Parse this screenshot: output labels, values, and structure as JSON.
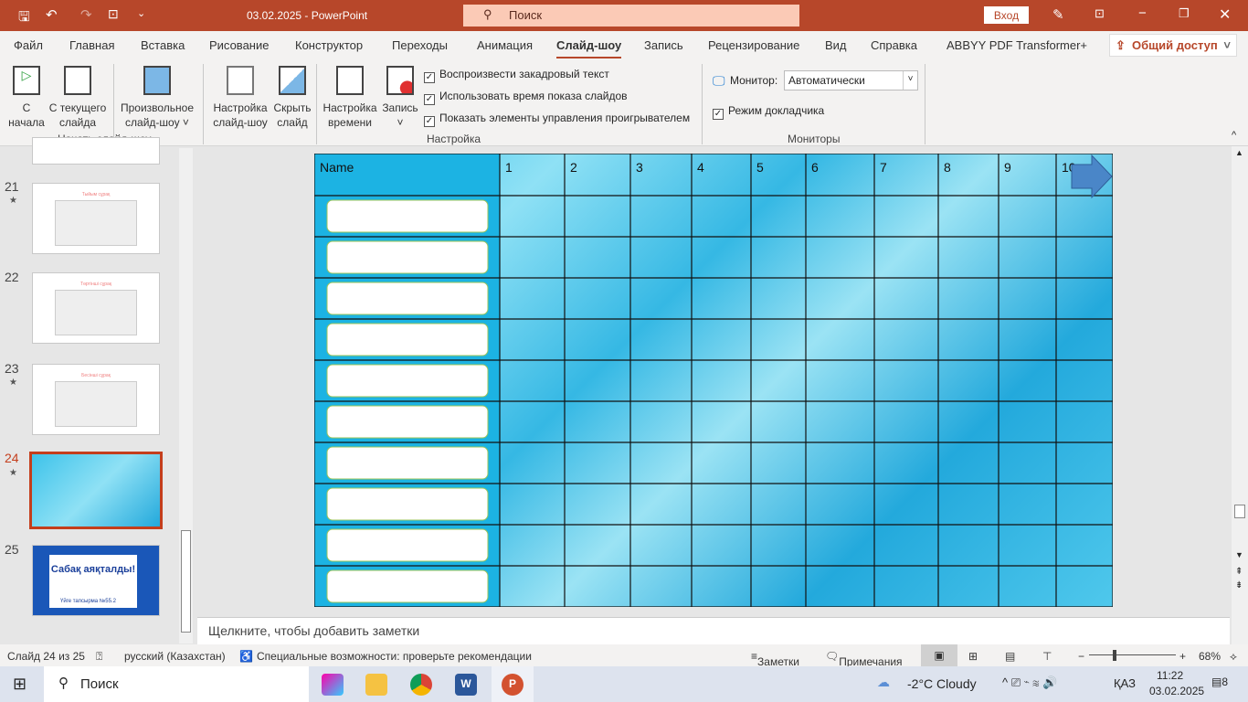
{
  "titlebar": {
    "title": "03.02.2025  -  PowerPoint",
    "search": "Поиск",
    "login": "Вход"
  },
  "tabs": [
    "Файл",
    "Главная",
    "Вставка",
    "Рисование",
    "Конструктор",
    "Переходы",
    "Анимация",
    "Слайд-шоу",
    "Запись",
    "Рецензирование",
    "Вид",
    "Справка",
    "ABBYY PDF Transformer+"
  ],
  "active_tab": "Слайд-шоу",
  "share": "Общий доступ",
  "ribbon": {
    "start": {
      "from_start": "С начала",
      "from_current": "С текущего слайда",
      "custom": "Произвольное слайд-шоу ˅",
      "group": "Начать слайд-шоу"
    },
    "setup": {
      "setup_show": "Настройка слайд-шоу",
      "hide_slide": "Скрыть слайд",
      "rehearse": "Настройка времени",
      "record": "Запись ˅",
      "group": "Настройка",
      "checks": [
        {
          "label": "Воспроизвести закадровый текст",
          "checked": true
        },
        {
          "label": "Использовать время показа слайдов",
          "checked": true
        },
        {
          "label": "Показать элементы управления проигрывателем",
          "checked": true
        }
      ]
    },
    "monitors": {
      "monitor_label": "Монитор:",
      "monitor_value": "Автоматически",
      "presenter": "Режим докладчика",
      "presenter_checked": true,
      "group": "Мониторы"
    }
  },
  "slides": [
    {
      "num": "21",
      "title": "Тыйым сұрақ"
    },
    {
      "num": "22",
      "title": "Төртінші сұрақ"
    },
    {
      "num": "23",
      "title": "Бесінші сұрақ"
    },
    {
      "num": "24",
      "selected": true
    },
    {
      "num": "25",
      "text": "Сабақ аяқталды!",
      "sub": "Үйге тапсырма №55.2"
    }
  ],
  "table": {
    "header": [
      "Name",
      "1",
      "2",
      "3",
      "4",
      "5",
      "6",
      "7",
      "8",
      "9",
      "10"
    ],
    "rows": 10
  },
  "notes_placeholder": "Щелкните, чтобы добавить заметки",
  "status": {
    "slide": "Слайд 24 из 25",
    "lang": "русский (Казахстан)",
    "access": "Специальные возможности: проверьте рекомендации",
    "notes": "Заметки",
    "comments": "Примечания",
    "zoom": "68%"
  },
  "taskbar": {
    "search": "Поиск",
    "weather": "-2°C  Cloudy",
    "lang": "ҚАЗ",
    "time": "11:22",
    "date": "03.02.2025",
    "notif": "8"
  },
  "colors": {
    "accent": "#b7472a",
    "water": "#3ec3ea"
  }
}
